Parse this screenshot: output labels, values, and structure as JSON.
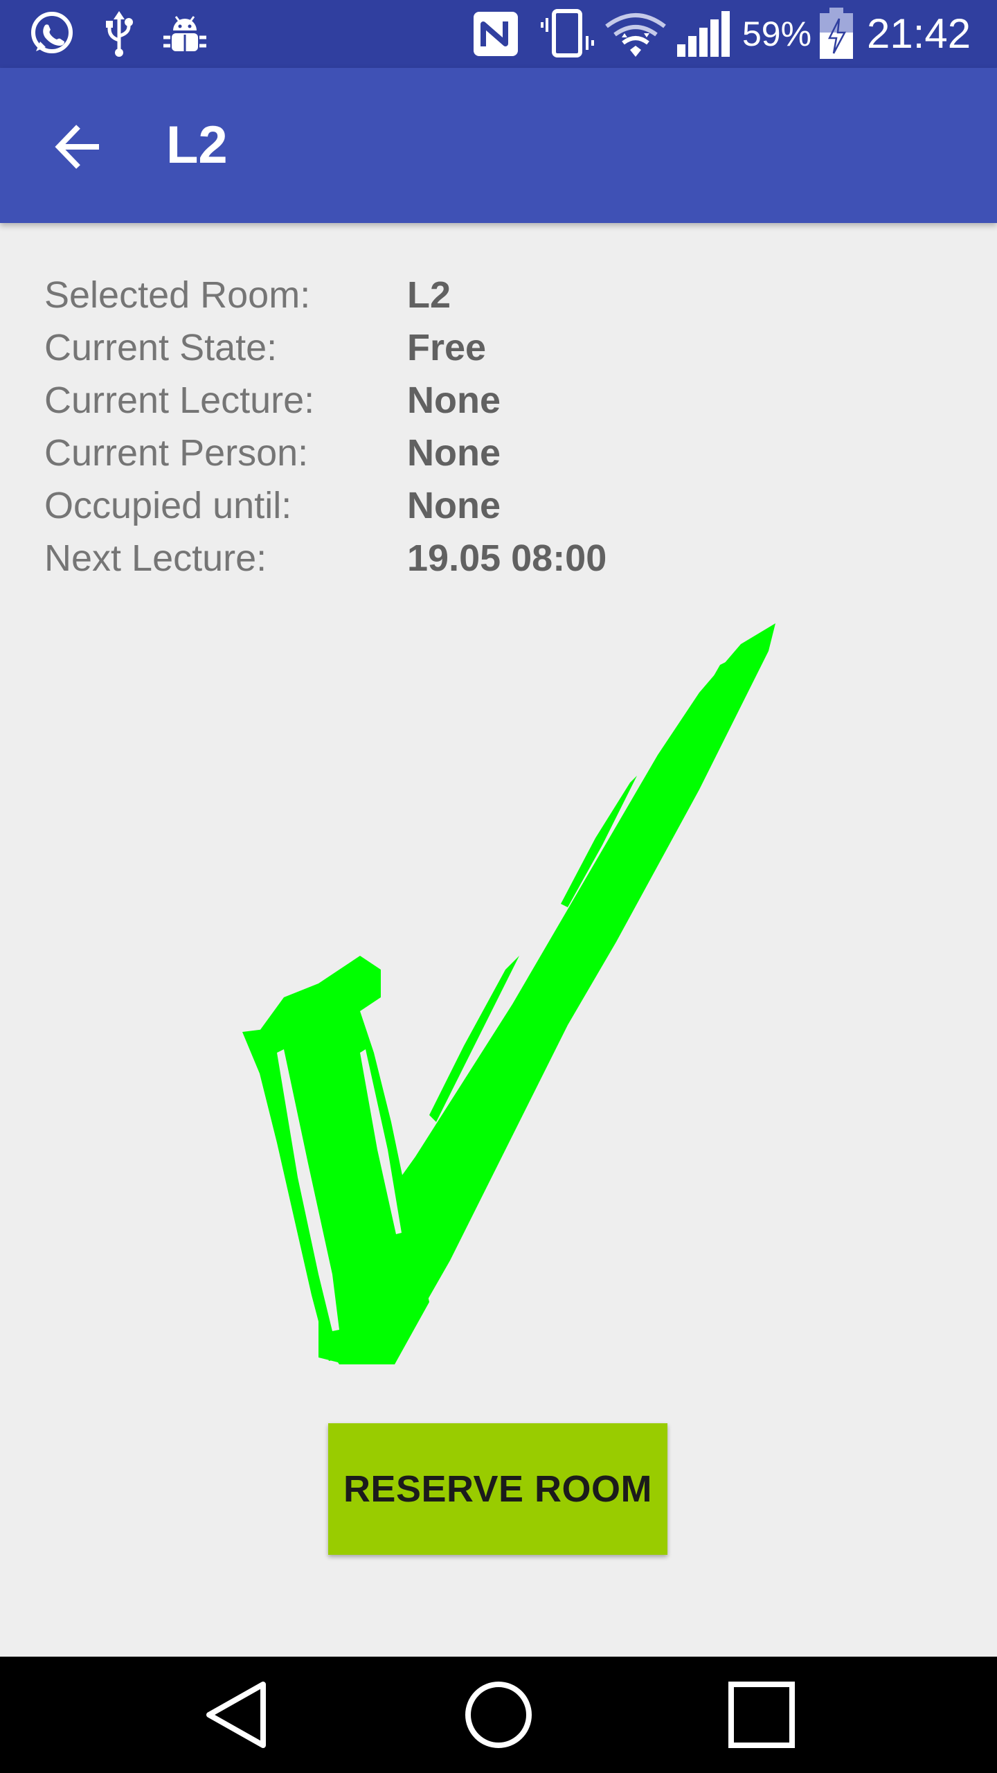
{
  "status_bar": {
    "battery_percent": "59%",
    "time": "21:42",
    "icons": [
      "whatsapp-icon",
      "usb-icon",
      "android-debug-icon",
      "nfc-icon",
      "vibrate-icon",
      "wifi-icon",
      "signal-icon",
      "battery-charging-icon"
    ]
  },
  "app_bar": {
    "back_icon": "arrow-back-icon",
    "title": "L2",
    "color": "#3f51b5"
  },
  "info": {
    "rows": [
      {
        "label": "Selected Room:",
        "value": "L2"
      },
      {
        "label": "Current State:",
        "value": "Free"
      },
      {
        "label": "Current Lecture:",
        "value": "None"
      },
      {
        "label": "Current Person:",
        "value": "None"
      },
      {
        "label": "Occupied until:",
        "value": "None"
      },
      {
        "label": "Next Lecture:",
        "value": "19.05 08:00"
      }
    ]
  },
  "status_graphic": {
    "icon": "checkmark-icon",
    "color": "#00ff00"
  },
  "reserve_button": {
    "label": "RESERVE ROOM",
    "color": "#99cc00"
  },
  "nav_bar": {
    "icons": [
      "back-triangle-icon",
      "home-circle-icon",
      "recents-square-icon"
    ]
  }
}
